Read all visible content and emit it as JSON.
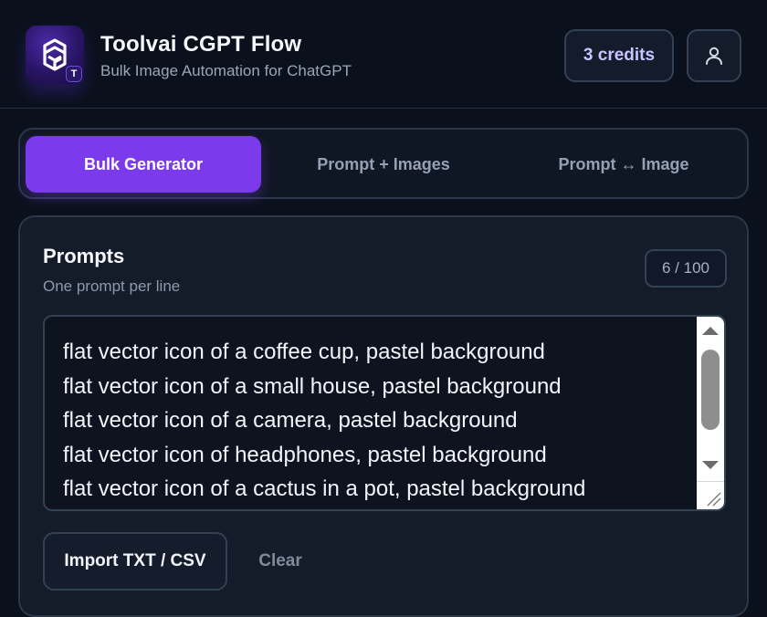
{
  "header": {
    "logo_icon": "openai-knot-logo-icon",
    "logo_badge": "T",
    "title": "Toolvai CGPT Flow",
    "subtitle": "Bulk Image Automation for ChatGPT",
    "credits_label": "3 credits",
    "account_icon": "user-icon"
  },
  "tabs": [
    {
      "label": "Bulk Generator",
      "active": true
    },
    {
      "label": "Prompt + Images",
      "active": false
    },
    {
      "label": "Prompt ↔ Image",
      "active": false
    }
  ],
  "prompts": {
    "title": "Prompts",
    "subtitle": "One prompt per line",
    "count": "6 / 100",
    "lines": [
      "flat vector icon of a coffee cup, pastel background",
      "flat vector icon of a small house, pastel background",
      "flat vector icon of a camera, pastel background",
      "flat vector icon of headphones, pastel background",
      "flat vector icon of a cactus in a pot, pastel background"
    ],
    "import_label": "Import TXT / CSV",
    "clear_label": "Clear"
  },
  "colors": {
    "background": "#0b111c",
    "accent": "#7c3aed",
    "credits_text": "#c8c4ff",
    "border": "#334155"
  }
}
